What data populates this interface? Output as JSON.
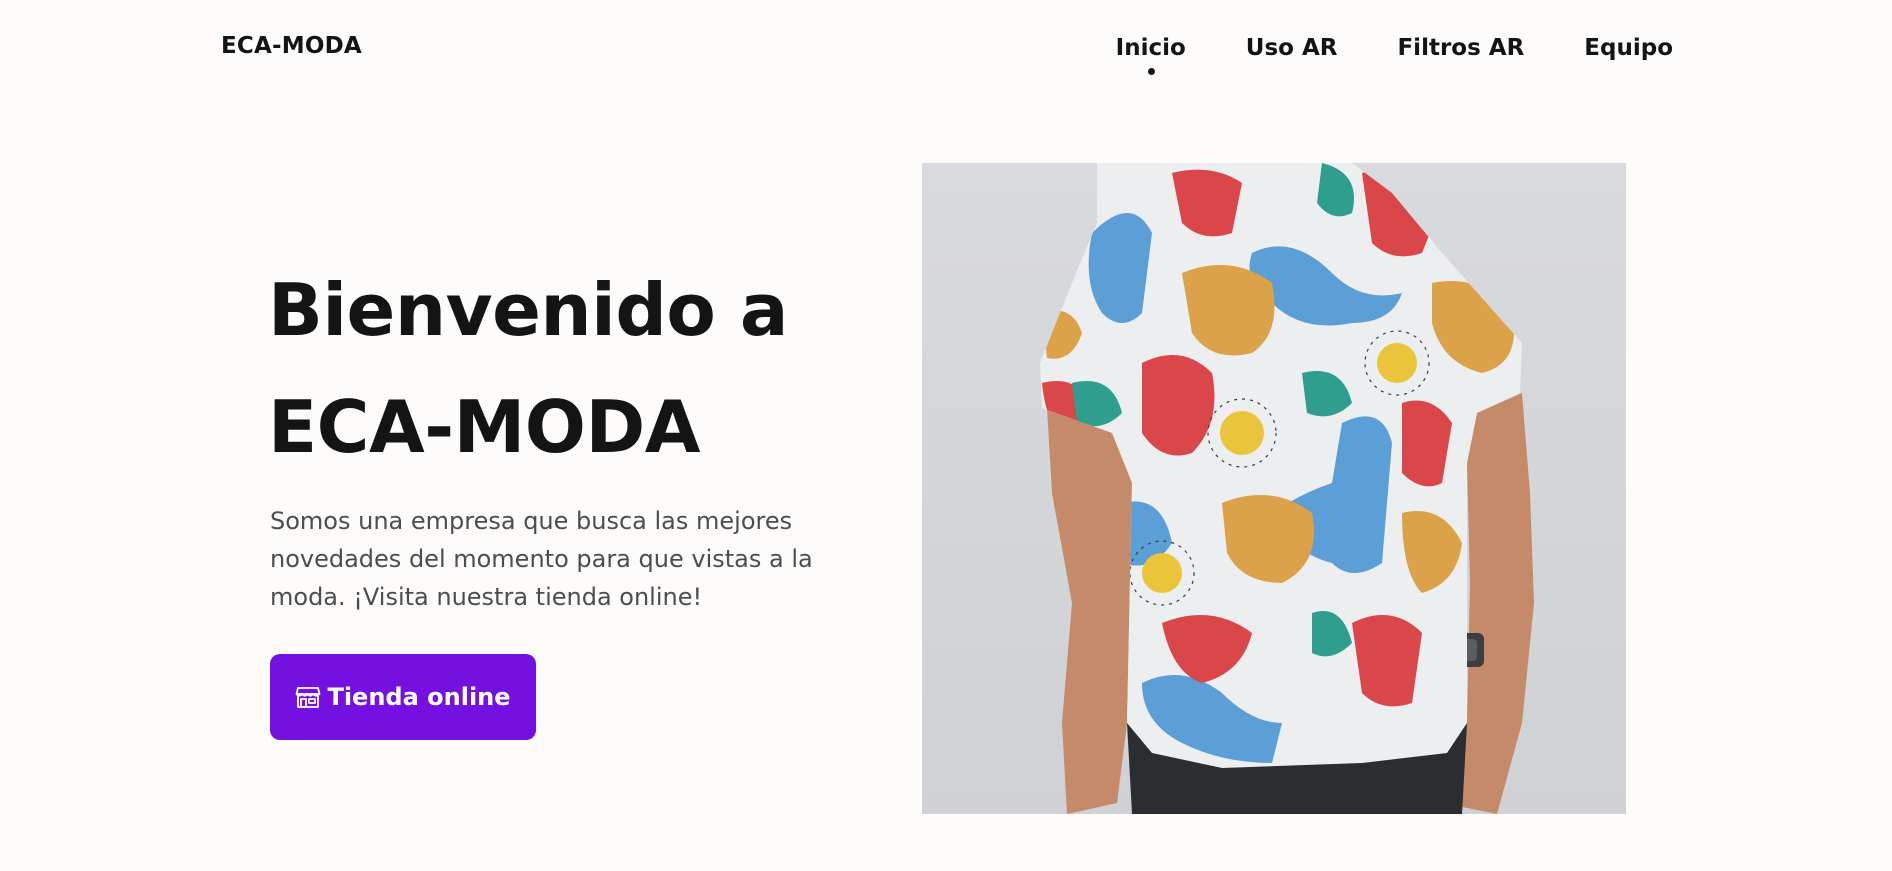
{
  "nav": {
    "brand": "ECA-MODA",
    "links": [
      {
        "label": "Inicio",
        "active": true
      },
      {
        "label": "Uso AR",
        "active": false
      },
      {
        "label": "Filtros AR",
        "active": false
      },
      {
        "label": "Equipo",
        "active": false
      }
    ]
  },
  "hero": {
    "title_line1": "Bienvenido a",
    "title_line2": "ECA-MODA",
    "description": "Somos una empresa que busca las mejores novedades del momento para que vistas a la moda. ¡Visita nuestra tienda online!",
    "button": {
      "label": "Tienda online",
      "icon": "storefront-icon"
    },
    "image": {
      "subject": "man-wearing-dinosaur-print-shirt"
    }
  },
  "colors": {
    "background": "#fdfcfb",
    "text": "#141414",
    "muted_text": "#4d4d4d",
    "accent": "#7511e0"
  }
}
